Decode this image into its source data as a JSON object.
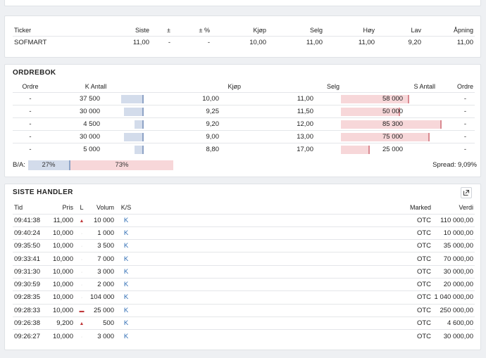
{
  "quote": {
    "headers": [
      "Ticker",
      "Siste",
      "±",
      "± %",
      "Kjøp",
      "Selg",
      "Høy",
      "Lav",
      "Åpning"
    ],
    "row": [
      "SOFMART",
      "11,00",
      "-",
      "-",
      "10,00",
      "11,00",
      "11,00",
      "9,20",
      "11,00"
    ]
  },
  "orderbook": {
    "title": "ORDREBOK",
    "headers": [
      "Ordre",
      "K Antall",
      "Kjøp",
      "Selg",
      "S Antall",
      "Ordre"
    ],
    "rows": [
      {
        "bo": "-",
        "bq": "37 500",
        "bqf": 0.44,
        "bp": "10,00",
        "sp": "11,00",
        "sq": "58 000",
        "sqf": 0.68,
        "so": "-"
      },
      {
        "bo": "-",
        "bq": "30 000",
        "bqf": 0.35,
        "bp": "9,25",
        "sp": "11,50",
        "sq": "50 000",
        "sqf": 0.59,
        "so": "-"
      },
      {
        "bo": "-",
        "bq": "4 500",
        "bqf": 0.05,
        "bp": "9,20",
        "sp": "12,00",
        "sq": "85 300",
        "sqf": 1.0,
        "so": "-"
      },
      {
        "bo": "-",
        "bq": "30 000",
        "bqf": 0.35,
        "bp": "9,00",
        "sp": "13,00",
        "sq": "75 000",
        "sqf": 0.88,
        "so": "-"
      },
      {
        "bo": "-",
        "bq": "5 000",
        "bqf": 0.06,
        "bp": "8,80",
        "sp": "17,00",
        "sq": "25 000",
        "sqf": 0.29,
        "so": "-"
      }
    ],
    "ba_label": "B/A:",
    "buy_pct": "27%",
    "sell_pct": "73%",
    "spread": "Spread: 9,09%"
  },
  "trades": {
    "title": "SISTE HANDLER",
    "headers": [
      "Tid",
      "Pris",
      "L",
      "Volum",
      "K/S",
      "Marked",
      "Verdi"
    ],
    "rows": [
      {
        "t": "09:41:38",
        "p": "11,000",
        "l": "up",
        "v": "10 000",
        "ks": "K",
        "m": "OTC",
        "val": "110 000,00"
      },
      {
        "t": "09:40:24",
        "p": "10,000",
        "l": "dn",
        "v": "1 000",
        "ks": "K",
        "m": "OTC",
        "val": "10 000,00"
      },
      {
        "t": "09:35:50",
        "p": "10,000",
        "l": "dn",
        "v": "3 500",
        "ks": "K",
        "m": "OTC",
        "val": "35 000,00"
      },
      {
        "t": "09:33:41",
        "p": "10,000",
        "l": "dn",
        "v": "7 000",
        "ks": "K",
        "m": "OTC",
        "val": "70 000,00"
      },
      {
        "t": "09:31:30",
        "p": "10,000",
        "l": "dn",
        "v": "3 000",
        "ks": "K",
        "m": "OTC",
        "val": "30 000,00"
      },
      {
        "t": "09:30:59",
        "p": "10,000",
        "l": "dn",
        "v": "2 000",
        "ks": "K",
        "m": "OTC",
        "val": "20 000,00"
      },
      {
        "t": "09:28:35",
        "p": "10,000",
        "l": "dn",
        "v": "104 000",
        "ks": "K",
        "m": "OTC",
        "val": "1 040 000,00"
      },
      {
        "t": "09:28:33",
        "p": "10,000",
        "l": "upd",
        "v": "25 000",
        "ks": "K",
        "m": "OTC",
        "val": "250 000,00"
      },
      {
        "t": "09:26:38",
        "p": "9,200",
        "l": "up",
        "v": "500",
        "ks": "K",
        "m": "OTC",
        "val": "4 600,00"
      },
      {
        "t": "09:26:27",
        "p": "10,000",
        "l": "dn",
        "v": "3 000",
        "ks": "K",
        "m": "OTC",
        "val": "30 000,00"
      }
    ]
  },
  "icons": {
    "external": "external-link-icon"
  },
  "colors": {
    "buy": "#d3dceb",
    "sell": "#f7d7d9",
    "link": "#2f6db5",
    "up": "#c0393b"
  }
}
